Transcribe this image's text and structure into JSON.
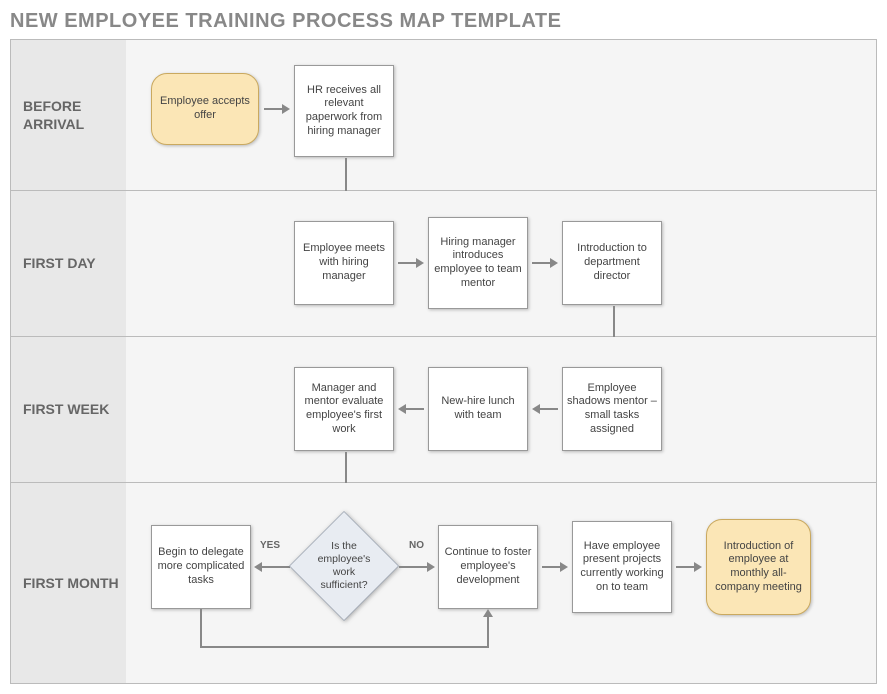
{
  "title": "NEW EMPLOYEE TRAINING PROCESS MAP TEMPLATE",
  "lanes": {
    "before": "BEFORE ARRIVAL",
    "day": "FIRST DAY",
    "week": "FIRST WEEK",
    "month": "FIRST MONTH"
  },
  "nodes": {
    "accepts": "Employee accepts offer",
    "hr_paperwork": "HR receives all relevant paperwork from hiring manager",
    "meets_manager": "Employee meets with hiring manager",
    "intro_mentor": "Hiring manager introduces employee to team mentor",
    "intro_director": "Introduction to department director",
    "shadows": "Employee shadows mentor – small tasks assigned",
    "lunch": "New-hire lunch with team",
    "evaluate": "Manager and mentor evaluate employee's first work",
    "decision": "Is the employee's work sufficient?",
    "delegate": "Begin to delegate more complicated tasks",
    "foster": "Continue to foster employee's development",
    "present": "Have employee present projects currently working on to team",
    "allhands": "Introduction of employee at monthly all-company meeting",
    "yes": "YES",
    "no": "NO"
  }
}
